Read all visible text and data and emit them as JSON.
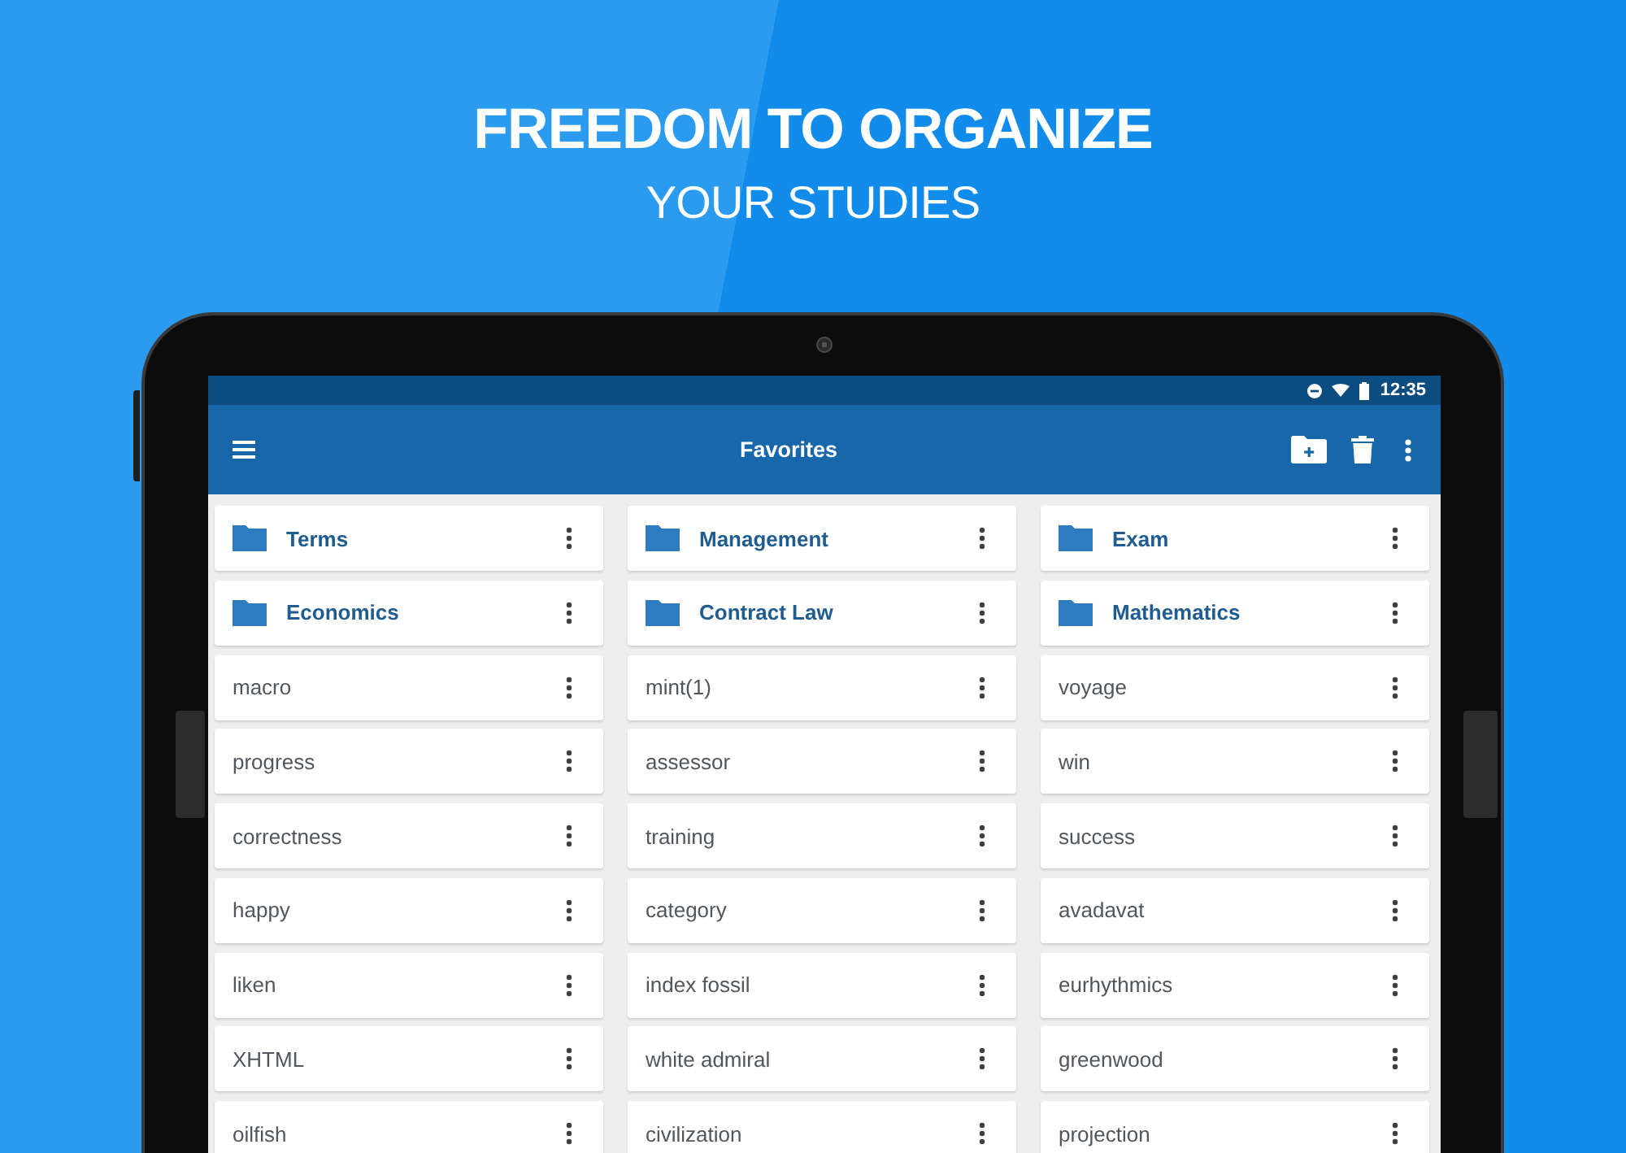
{
  "banner": {
    "headline": "FREEDOM TO ORGANIZE",
    "subheadline": "YOUR STUDIES"
  },
  "status_bar": {
    "time": "12:35"
  },
  "app_bar": {
    "title": "Favorites"
  },
  "items": [
    {
      "kind": "folder",
      "name": "Terms"
    },
    {
      "kind": "folder",
      "name": "Management"
    },
    {
      "kind": "folder",
      "name": "Exam"
    },
    {
      "kind": "folder",
      "name": "Economics"
    },
    {
      "kind": "folder",
      "name": "Contract Law"
    },
    {
      "kind": "folder",
      "name": "Mathematics"
    },
    {
      "kind": "file",
      "name": "macro"
    },
    {
      "kind": "file",
      "name": "mint(1)"
    },
    {
      "kind": "file",
      "name": "voyage"
    },
    {
      "kind": "file",
      "name": "progress"
    },
    {
      "kind": "file",
      "name": "assessor"
    },
    {
      "kind": "file",
      "name": "win"
    },
    {
      "kind": "file",
      "name": "correctness"
    },
    {
      "kind": "file",
      "name": "training"
    },
    {
      "kind": "file",
      "name": "success"
    },
    {
      "kind": "file",
      "name": "happy"
    },
    {
      "kind": "file",
      "name": "category"
    },
    {
      "kind": "file",
      "name": "avadavat"
    },
    {
      "kind": "file",
      "name": "liken"
    },
    {
      "kind": "file",
      "name": "index fossil"
    },
    {
      "kind": "file",
      "name": "eurhythmics"
    },
    {
      "kind": "file",
      "name": "XHTML"
    },
    {
      "kind": "file",
      "name": "white admiral"
    },
    {
      "kind": "file",
      "name": "greenwood"
    },
    {
      "kind": "file",
      "name": "oilfish"
    },
    {
      "kind": "file",
      "name": "civilization"
    },
    {
      "kind": "file",
      "name": "projection"
    }
  ]
}
